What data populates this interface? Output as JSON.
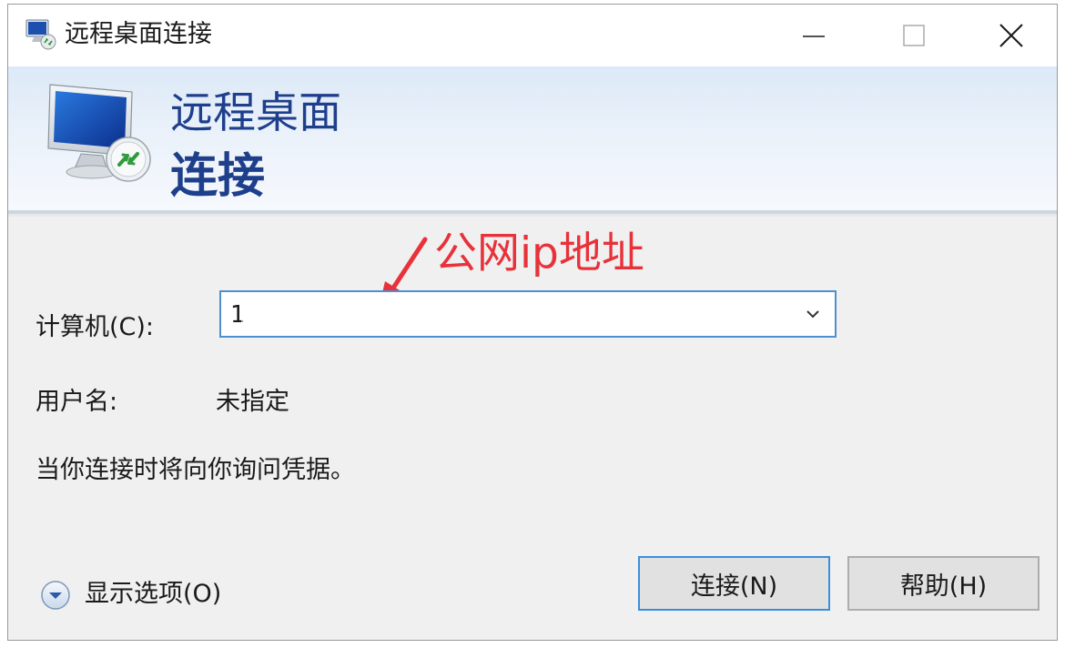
{
  "window": {
    "title": "远程桌面连接"
  },
  "banner": {
    "line1": "远程桌面",
    "line2": "连接"
  },
  "annotation": {
    "text": "公网ip地址",
    "color": "#e8323a"
  },
  "form": {
    "computer_label": "计算机(C):",
    "computer_value": "1",
    "user_label": "用户名:",
    "user_value": "未指定",
    "prompt_text": "当你连接时将向你询问凭据。"
  },
  "options": {
    "label": "显示选项(O)"
  },
  "buttons": {
    "connect_label": "连接(N)",
    "help_label": "帮助(H)"
  },
  "colors": {
    "banner_text": "#1e3f8c",
    "focus_border": "#3c8edb"
  },
  "icons": {
    "app": "remote-desktop-icon",
    "minimize": "minimize-icon",
    "maximize": "maximize-icon",
    "close": "close-icon",
    "dropdown": "chevron-down-icon",
    "options": "expand-circle-icon"
  }
}
